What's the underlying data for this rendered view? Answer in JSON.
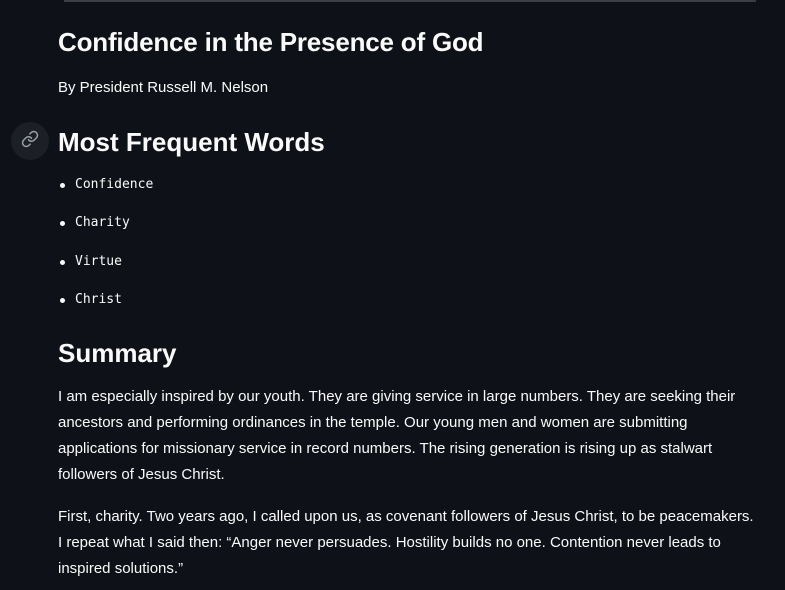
{
  "article": {
    "title": "Confidence in the Presence of God",
    "byline": "By President Russell M. Nelson"
  },
  "sections": {
    "frequent_words": {
      "heading": "Most Frequent Words",
      "items": [
        "Confidence",
        "Charity",
        "Virtue",
        "Christ"
      ]
    },
    "summary": {
      "heading": "Summary",
      "paragraphs": [
        "I am especially inspired by our youth. They are giving service in large numbers. They are seeking their ancestors and performing ordinances in the temple. Our young men and women are submitting applications for missionary service in record numbers. The rising generation is rising up as stalwart followers of Jesus Christ.",
        "First, charity. Two years ago, I called upon us, as covenant followers of Jesus Christ, to be peacemakers. I repeat what I said then: “Anger never persuades. Hostility builds no one. Contention never leads to inspired solutions.”"
      ]
    }
  },
  "icons": {
    "anchor_link": "link-icon"
  },
  "colors": {
    "background": "#0e1117",
    "text": "#fafafa",
    "anchor_bg": "#1c1f26",
    "rule": "#3a3d45"
  }
}
